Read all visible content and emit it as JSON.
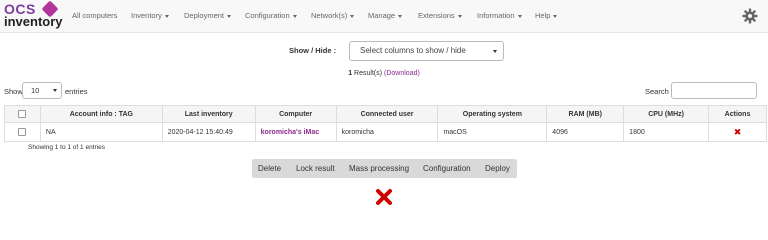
{
  "logo": {
    "top": "OCS",
    "bottom": "inventory"
  },
  "nav": {
    "items": [
      {
        "label": "All computers",
        "dropdown": false
      },
      {
        "label": "Inventory",
        "dropdown": true
      },
      {
        "label": "Deployment",
        "dropdown": true
      },
      {
        "label": "Configuration",
        "dropdown": true
      },
      {
        "label": "Network(s)",
        "dropdown": true
      },
      {
        "label": "Manage",
        "dropdown": true
      },
      {
        "label": "Extensions",
        "dropdown": true
      },
      {
        "label": "Information",
        "dropdown": true
      },
      {
        "label": "Help",
        "dropdown": true
      }
    ],
    "settings_icon": "gear-icon"
  },
  "show_hide": {
    "label": "Show / Hide :",
    "placeholder": "Select columns to show / hide"
  },
  "results": {
    "count": "1",
    "text": "Result(s)",
    "download": "(Download)"
  },
  "table_controls": {
    "show_label": "Show",
    "entries_value": "10",
    "entries_label": "entries",
    "search_label": "Search :",
    "search_value": ""
  },
  "table": {
    "columns": [
      "Account info : TAG",
      "Last inventory",
      "Computer",
      "Connected user",
      "Operating system",
      "RAM (MB)",
      "CPU (MHz)",
      "Actions"
    ],
    "rows": [
      {
        "tag": "NA",
        "last_inventory": "2020-04-12 15:40:49",
        "computer": "koromicha's iMac",
        "connected_user": "koromicha",
        "os": "macOS",
        "ram": "4096",
        "cpu": "1800",
        "action_icon": "delete-icon",
        "action_glyph": "✖"
      }
    ]
  },
  "showing_text": "Showing 1 to 1 of 1 entries",
  "actions": {
    "delete": "Delete",
    "lock": "Lock result",
    "mass": "Mass processing",
    "configuration": "Configuration",
    "deploy": "Deploy"
  },
  "colors": {
    "accent": "#8b2a8b",
    "danger": "#cc0000",
    "navbar_bg": "#f8f8f8",
    "action_bar_bg": "#d9d9d9"
  }
}
